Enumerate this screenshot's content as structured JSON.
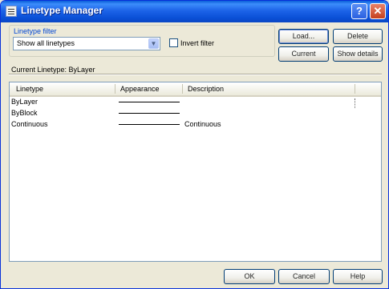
{
  "window": {
    "title": "Linetype Manager"
  },
  "titlebar": {
    "help_glyph": "?",
    "close_glyph": "✕"
  },
  "filter": {
    "group_label": "Linetype filter",
    "selected": "Show all linetypes",
    "invert_label": "Invert filter",
    "invert_checked": false
  },
  "buttons": {
    "load": "Load...",
    "delete": "Delete",
    "current": "Current",
    "show_details": "Show details",
    "ok": "OK",
    "cancel": "Cancel",
    "help": "Help"
  },
  "current_linetype": "Current Linetype:  ByLayer",
  "table": {
    "headers": [
      "Linetype",
      "Appearance",
      "Description"
    ],
    "rows": [
      {
        "name": "ByLayer",
        "description": ""
      },
      {
        "name": "ByBlock",
        "description": ""
      },
      {
        "name": "Continuous",
        "description": "Continuous"
      }
    ]
  },
  "colors": {
    "titlebar": "#0a4fd6",
    "window_bg": "#ece9d8"
  }
}
